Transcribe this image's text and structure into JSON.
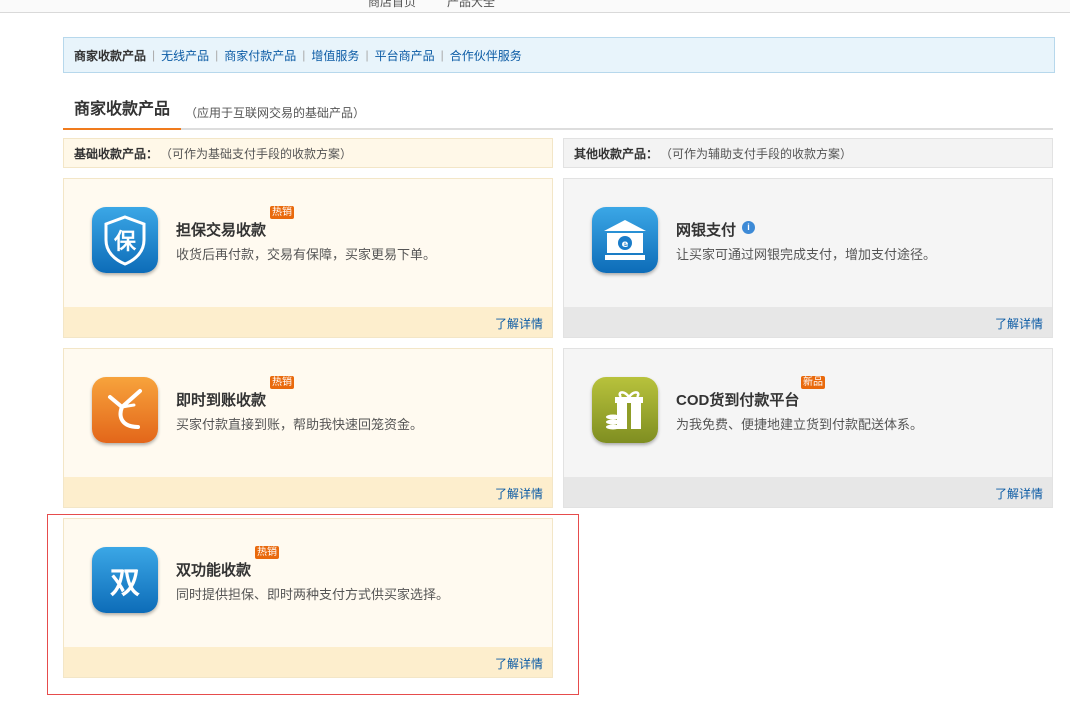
{
  "topbar": {
    "link1": "商店首页",
    "link2": "产品大全"
  },
  "subnav": {
    "items": [
      "商家收款产品",
      "无线产品",
      "商家付款产品",
      "增值服务",
      "平台商产品",
      "合作伙伴服务"
    ]
  },
  "section": {
    "title": "商家收款产品",
    "subtitle": "（应用于互联网交易的基础产品）"
  },
  "columns": {
    "left": {
      "label": "基础收款产品：",
      "note": "（可作为基础支付手段的收款方案）"
    },
    "right": {
      "label": "其他收款产品：",
      "note": "（可作为辅助支付手段的收款方案）"
    }
  },
  "cards": [
    {
      "title": "担保交易收款",
      "desc": "收货后再付款，交易有保障，买家更易下单。",
      "badge": "热销",
      "icon_glyph": "保",
      "icon_name": "shield-guarantee-icon",
      "link": "了解详情"
    },
    {
      "title": "网银支付",
      "desc": "让买家可通过网银完成支付，增加支付途径。",
      "badge": "",
      "icon_glyph": "",
      "icon_name": "bank-icon",
      "link": "了解详情",
      "info": "i"
    },
    {
      "title": "即时到账收款",
      "desc": "买家付款直接到账，帮助我快速回笼资金。",
      "badge": "热销",
      "icon_glyph": "",
      "icon_name": "instant-arrow-icon",
      "link": "了解详情"
    },
    {
      "title": "COD货到付款平台",
      "desc": "为我免费、便捷地建立货到付款配送体系。",
      "badge": "新品",
      "icon_glyph": "",
      "icon_name": "gift-box-icon",
      "link": "了解详情"
    },
    {
      "title": "双功能收款",
      "desc": "同时提供担保、即时两种支付方式供买家选择。",
      "badge": "热销",
      "icon_glyph": "双",
      "icon_name": "dual-function-icon",
      "link": "了解详情"
    }
  ],
  "colors": {
    "accent": "#f07b1d",
    "link": "#0b5ba5",
    "badge": "#e9690c",
    "highlight_border": "#e64c4c"
  }
}
